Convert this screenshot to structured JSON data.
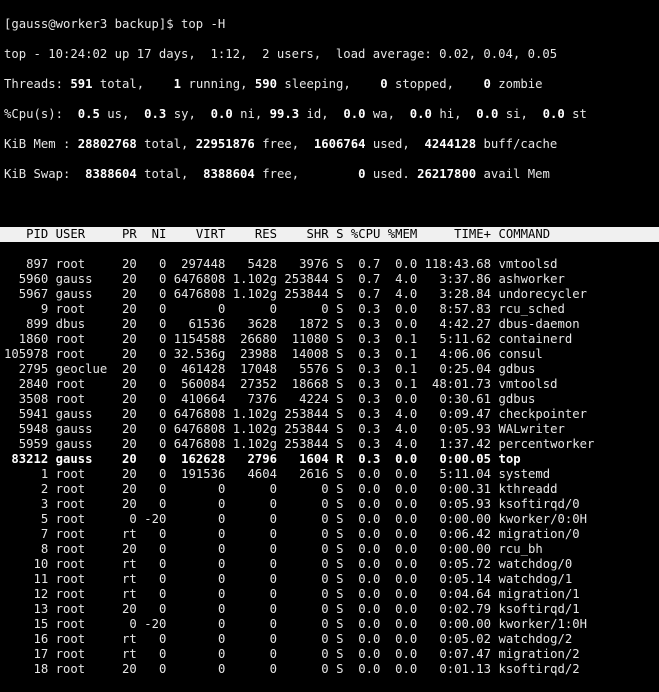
{
  "shell": {
    "prompt": "[gauss@worker3 backup]$ ",
    "command": "top -H"
  },
  "summary": {
    "uptime_line": "top - 10:24:02 up 17 days,  1:12,  2 users,  load average: 0.02, 0.04, 0.05",
    "threads": {
      "label": "Threads: ",
      "total": "591",
      "total_label": " total,    ",
      "running": "1",
      "running_label": " running, ",
      "sleeping": "590",
      "sleeping_label": " sleeping,    ",
      "stopped": "0",
      "stopped_label": " stopped,    ",
      "zombie": "0",
      "zombie_label": " zombie"
    },
    "cpu": {
      "label": "%Cpu(s):  ",
      "us": "0.5",
      "us_label": " us,  ",
      "sy": "0.3",
      "sy_label": " sy,  ",
      "ni": "0.0",
      "ni_label": " ni, ",
      "id": "99.3",
      "id_label": " id,  ",
      "wa": "0.0",
      "wa_label": " wa,  ",
      "hi": "0.0",
      "hi_label": " hi,  ",
      "si": "0.0",
      "si_label": " si,  ",
      "st": "0.0",
      "st_label": " st"
    },
    "mem": {
      "label": "KiB Mem : ",
      "total": "28802768",
      "total_label": " total, ",
      "free": "22951876",
      "free_label": " free,  ",
      "used": "1606764",
      "used_label": " used,  ",
      "buff": "4244128",
      "buff_label": " buff/cache"
    },
    "swap": {
      "label": "KiB Swap:  ",
      "total": "8388604",
      "total_label": " total,  ",
      "free": "8388604",
      "free_label": " free,        ",
      "used": "0",
      "used_label": " used. ",
      "avail": "26217800",
      "avail_label": " avail Mem"
    }
  },
  "table": {
    "columns": [
      "PID",
      "USER",
      "PR",
      "NI",
      "VIRT",
      "RES",
      "SHR",
      "S",
      "%CPU",
      "%MEM",
      "TIME+",
      "COMMAND"
    ],
    "rows": [
      [
        "897",
        "root",
        "20",
        "0",
        "297448",
        "5428",
        "3976",
        "S",
        "0.7",
        "0.0",
        "118:43.68",
        "vmtoolsd"
      ],
      [
        "5960",
        "gauss",
        "20",
        "0",
        "6476808",
        "1.102g",
        "253844",
        "S",
        "0.7",
        "4.0",
        "3:37.86",
        "ashworker"
      ],
      [
        "5967",
        "gauss",
        "20",
        "0",
        "6476808",
        "1.102g",
        "253844",
        "S",
        "0.7",
        "4.0",
        "3:28.84",
        "undorecycler"
      ],
      [
        "9",
        "root",
        "20",
        "0",
        "0",
        "0",
        "0",
        "S",
        "0.3",
        "0.0",
        "8:57.83",
        "rcu_sched"
      ],
      [
        "899",
        "dbus",
        "20",
        "0",
        "61536",
        "3628",
        "1872",
        "S",
        "0.3",
        "0.0",
        "4:42.27",
        "dbus-daemon"
      ],
      [
        "1860",
        "root",
        "20",
        "0",
        "1154588",
        "26680",
        "11080",
        "S",
        "0.3",
        "0.1",
        "5:11.62",
        "containerd"
      ],
      [
        "105978",
        "root",
        "20",
        "0",
        "32.536g",
        "23988",
        "14008",
        "S",
        "0.3",
        "0.1",
        "4:06.06",
        "consul"
      ],
      [
        "2795",
        "geoclue",
        "20",
        "0",
        "461428",
        "17048",
        "5576",
        "S",
        "0.3",
        "0.1",
        "0:25.04",
        "gdbus"
      ],
      [
        "2840",
        "root",
        "20",
        "0",
        "560084",
        "27352",
        "18668",
        "S",
        "0.3",
        "0.1",
        "48:01.73",
        "vmtoolsd"
      ],
      [
        "3508",
        "root",
        "20",
        "0",
        "410664",
        "7376",
        "4224",
        "S",
        "0.3",
        "0.0",
        "0:30.61",
        "gdbus"
      ],
      [
        "5941",
        "gauss",
        "20",
        "0",
        "6476808",
        "1.102g",
        "253844",
        "S",
        "0.3",
        "4.0",
        "0:09.47",
        "checkpointer"
      ],
      [
        "5948",
        "gauss",
        "20",
        "0",
        "6476808",
        "1.102g",
        "253844",
        "S",
        "0.3",
        "4.0",
        "0:05.93",
        "WALwriter"
      ],
      [
        "5959",
        "gauss",
        "20",
        "0",
        "6476808",
        "1.102g",
        "253844",
        "S",
        "0.3",
        "4.0",
        "1:37.42",
        "percentworker"
      ],
      [
        "83212",
        "gauss",
        "20",
        "0",
        "162628",
        "2796",
        "1604",
        "R",
        "0.3",
        "0.0",
        "0:00.05",
        "top"
      ],
      [
        "1",
        "root",
        "20",
        "0",
        "191536",
        "4604",
        "2616",
        "S",
        "0.0",
        "0.0",
        "5:11.04",
        "systemd"
      ],
      [
        "2",
        "root",
        "20",
        "0",
        "0",
        "0",
        "0",
        "S",
        "0.0",
        "0.0",
        "0:00.31",
        "kthreadd"
      ],
      [
        "3",
        "root",
        "20",
        "0",
        "0",
        "0",
        "0",
        "S",
        "0.0",
        "0.0",
        "0:05.93",
        "ksoftirqd/0"
      ],
      [
        "5",
        "root",
        "0",
        "-20",
        "0",
        "0",
        "0",
        "S",
        "0.0",
        "0.0",
        "0:00.00",
        "kworker/0:0H"
      ],
      [
        "7",
        "root",
        "rt",
        "0",
        "0",
        "0",
        "0",
        "S",
        "0.0",
        "0.0",
        "0:06.42",
        "migration/0"
      ],
      [
        "8",
        "root",
        "20",
        "0",
        "0",
        "0",
        "0",
        "S",
        "0.0",
        "0.0",
        "0:00.00",
        "rcu_bh"
      ],
      [
        "10",
        "root",
        "rt",
        "0",
        "0",
        "0",
        "0",
        "S",
        "0.0",
        "0.0",
        "0:05.72",
        "watchdog/0"
      ],
      [
        "11",
        "root",
        "rt",
        "0",
        "0",
        "0",
        "0",
        "S",
        "0.0",
        "0.0",
        "0:05.14",
        "watchdog/1"
      ],
      [
        "12",
        "root",
        "rt",
        "0",
        "0",
        "0",
        "0",
        "S",
        "0.0",
        "0.0",
        "0:04.64",
        "migration/1"
      ],
      [
        "13",
        "root",
        "20",
        "0",
        "0",
        "0",
        "0",
        "S",
        "0.0",
        "0.0",
        "0:02.79",
        "ksoftirqd/1"
      ],
      [
        "15",
        "root",
        "0",
        "-20",
        "0",
        "0",
        "0",
        "S",
        "0.0",
        "0.0",
        "0:00.00",
        "kworker/1:0H"
      ],
      [
        "16",
        "root",
        "rt",
        "0",
        "0",
        "0",
        "0",
        "S",
        "0.0",
        "0.0",
        "0:05.02",
        "watchdog/2"
      ],
      [
        "17",
        "root",
        "rt",
        "0",
        "0",
        "0",
        "0",
        "S",
        "0.0",
        "0.0",
        "0:07.47",
        "migration/2"
      ],
      [
        "18",
        "root",
        "20",
        "0",
        "0",
        "0",
        "0",
        "S",
        "0.0",
        "0.0",
        "0:01.13",
        "ksoftirqd/2"
      ]
    ],
    "highlight_pid": "83212"
  }
}
